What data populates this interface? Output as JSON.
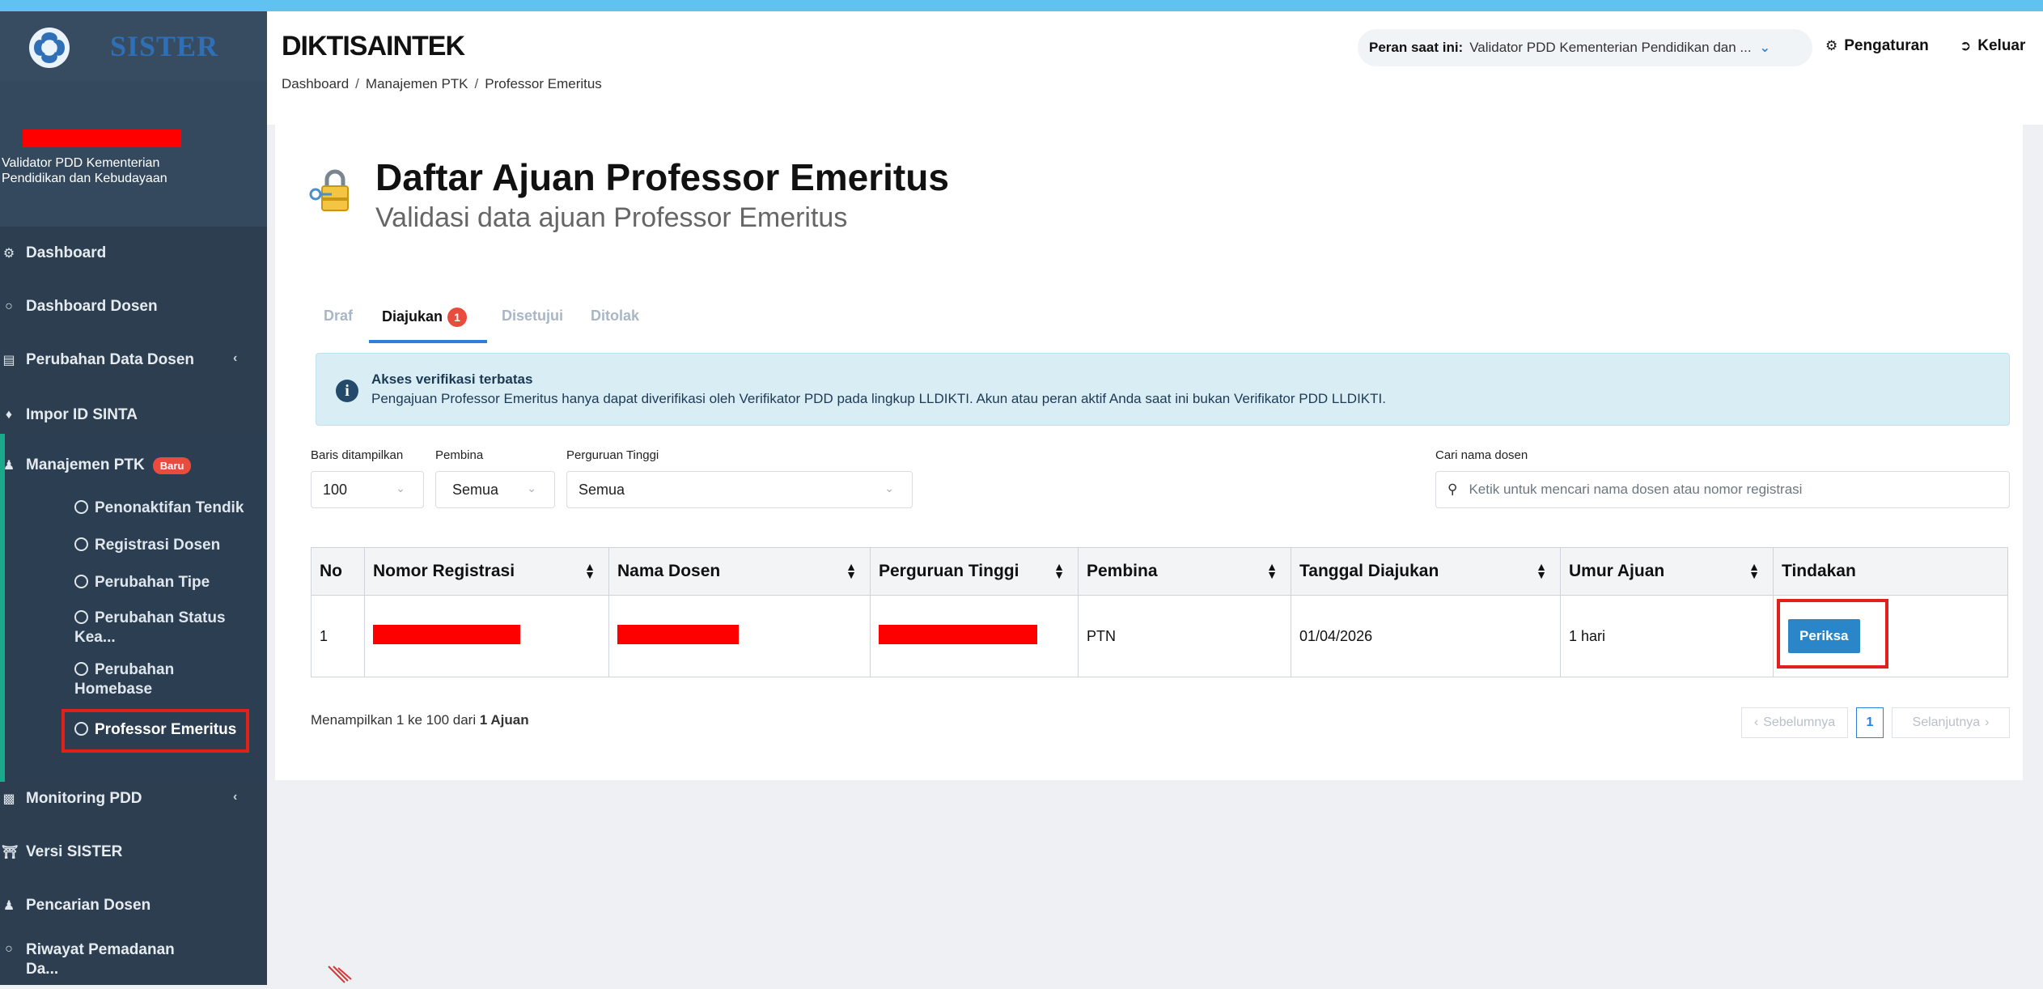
{
  "sidebar": {
    "brand": "SISTER",
    "user_role": "Validator PDD Kementerian Pendidikan dan Kebudayaan",
    "items": [
      {
        "label": "Dashboard",
        "icon": "dashboard-icon"
      },
      {
        "label": "Dashboard Dosen",
        "icon": "circle-icon"
      },
      {
        "label": "Perubahan Data Dosen",
        "icon": "document-icon"
      },
      {
        "label": "Impor ID SINTA",
        "icon": "import-icon"
      },
      {
        "label": "Manajemen PTK",
        "icon": "user-icon",
        "badge": "Baru"
      },
      {
        "label": "Monitoring PDD",
        "icon": "chart-icon"
      },
      {
        "label": "Versi SISTER",
        "icon": "bank-icon"
      },
      {
        "label": "Pencarian Dosen",
        "icon": "users-icon"
      },
      {
        "label": "Riwayat Pemadanan Da...",
        "icon": "circle-icon"
      }
    ],
    "sub_items": [
      "Penonaktifan Tendik",
      "Registrasi Dosen",
      "Perubahan Tipe",
      "Perubahan Status Kea...",
      "Perubahan Homebase",
      "Professor Emeritus"
    ]
  },
  "header": {
    "title": "DIKTISAINTEK",
    "breadcrumb": [
      "Dashboard",
      "Manajemen PTK",
      "Professor Emeritus"
    ],
    "role_label": "Peran saat ini:",
    "role_value": "Validator PDD Kementerian Pendidikan dan ...",
    "settings": "Pengaturan",
    "logout": "Keluar"
  },
  "page": {
    "title": "Daftar Ajuan Professor Emeritus",
    "subtitle": "Validasi data ajuan Professor Emeritus",
    "tabs": [
      {
        "label": "Draf"
      },
      {
        "label": "Diajukan",
        "count": "1"
      },
      {
        "label": "Disetujui"
      },
      {
        "label": "Ditolak"
      }
    ],
    "alert": {
      "title": "Akses verifikasi terbatas",
      "text": "Pengajuan Professor Emeritus hanya dapat diverifikasi oleh Verifikator PDD pada lingkup LLDIKTI. Akun atau peran aktif Anda saat ini bukan Verifikator PDD LLDIKTI."
    },
    "filters": {
      "rows_label": "Baris ditampilkan",
      "rows_value": "100",
      "pembina_label": "Pembina",
      "pembina_value": "Semua",
      "pt_label": "Perguruan Tinggi",
      "pt_value": "Semua",
      "search_label": "Cari nama dosen",
      "search_placeholder": "Ketik untuk mencari nama dosen atau nomor registrasi"
    },
    "table": {
      "headers": [
        "No",
        "Nomor Registrasi",
        "Nama Dosen",
        "Perguruan Tinggi",
        "Pembina",
        "Tanggal Diajukan",
        "Umur Ajuan",
        "Tindakan"
      ],
      "rows": [
        {
          "no": "1",
          "pembina": "PTN",
          "tanggal": "01/04/2026",
          "umur": "1 hari",
          "action": "Periksa"
        }
      ]
    },
    "footer": {
      "info_prefix": "Menampilkan 1 ke 100 dari",
      "info_bold": "1 Ajuan",
      "prev": "Sebelumnya",
      "current": "1",
      "next": "Selanjutnya"
    }
  }
}
